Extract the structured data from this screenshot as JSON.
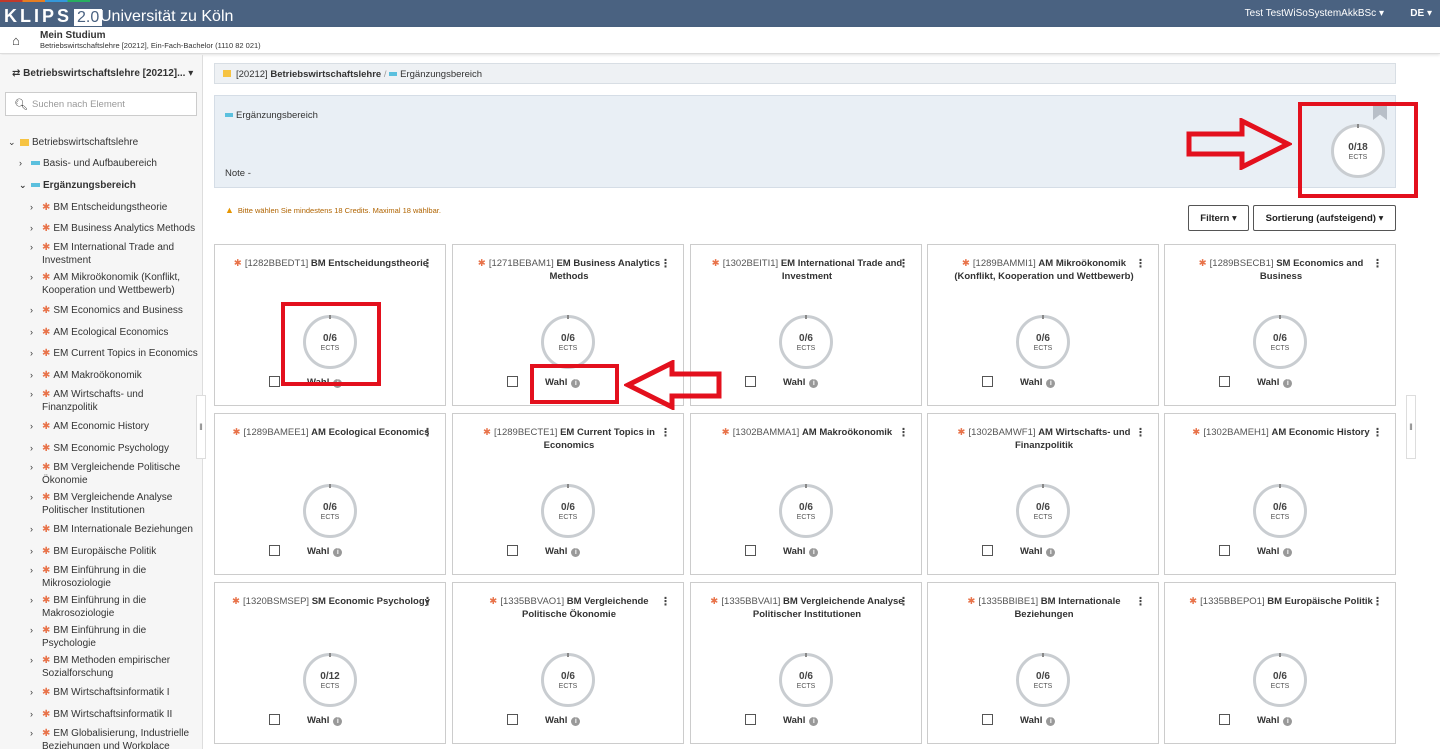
{
  "topbar": {
    "brand": "KLIPS",
    "version": "2.0",
    "university": "Universität zu Köln",
    "user": "Test TestWiSoSystemAkkBSc",
    "language": "DE"
  },
  "subheader": {
    "title": "Mein Studium",
    "subtitle": "Betriebswirtschaftslehre [20212], Ein-Fach-Bachelor (1110 82 021)"
  },
  "sidebar": {
    "program_selector": "Betriebswirtschaftslehre [20212]...",
    "search_placeholder": "Suchen nach Element",
    "tree": {
      "root": "Betriebswirtschaftslehre",
      "basis": "Basis- und Aufbaubereich",
      "erg": "Ergänzungsbereich",
      "items": [
        "BM Entscheidungstheorie",
        "EM Business Analytics Methods",
        "EM International Trade and Investment",
        "AM Mikroökonomik (Konflikt, Kooperation und Wettbewerb)",
        "SM Economics and Business",
        "AM Ecological Economics",
        "EM Current Topics in Economics",
        "AM Makroökonomik",
        "AM Wirtschafts- und Finanzpolitik",
        "AM Economic History",
        "SM Economic Psychology",
        "BM Vergleichende Politische Ökonomie",
        "BM Vergleichende Analyse Politischer Institutionen",
        "BM Internationale Beziehungen",
        "BM Europäische Politik",
        "BM Einführung in die Mikrosoziologie",
        "BM Einführung in die Makrosoziologie",
        "BM Einführung in die Psychologie",
        "BM Methoden empirischer Sozialforschung",
        "BM Wirtschaftsinformatik I",
        "BM Wirtschaftsinformatik II",
        "EM Globalisierung, Industrielle Beziehungen und Workplace"
      ]
    }
  },
  "breadcrumb": {
    "code": "[20212]",
    "program": "Betriebswirtschaftslehre",
    "separator": "/",
    "current": "Ergänzungsbereich"
  },
  "panel": {
    "title": "Ergänzungsbereich",
    "note_label": "Note",
    "note_value": "-",
    "ects_value": "0/18",
    "ects_unit": "ECTS"
  },
  "warning": "Bitte wählen Sie mindestens 18 Credits. Maximal 18 wählbar.",
  "toolbar": {
    "filter": "Filtern ▾",
    "sort": "Sortierung (aufsteigend) ▾"
  },
  "card_labels": {
    "wahl": "Wahl",
    "ects": "ECTS"
  },
  "cards": [
    {
      "code": "[1282BBEDT1]",
      "name": "BM Entscheidungstheorie",
      "ects": "0/6"
    },
    {
      "code": "[1271BEBAM1]",
      "name": "EM Business Analytics Methods",
      "ects": "0/6"
    },
    {
      "code": "[1302BEITI1]",
      "name": "EM International Trade and Investment",
      "ects": "0/6"
    },
    {
      "code": "[1289BAMMI1]",
      "name": "AM Mikroökonomik (Konflikt, Kooperation und Wettbewerb)",
      "ects": "0/6"
    },
    {
      "code": "[1289BSECB1]",
      "name": "SM Economics and Business",
      "ects": "0/6"
    },
    {
      "code": "[1289BAMEE1]",
      "name": "AM Ecological Economics",
      "ects": "0/6"
    },
    {
      "code": "[1289BECTE1]",
      "name": "EM Current Topics in Economics",
      "ects": "0/6"
    },
    {
      "code": "[1302BAMMA1]",
      "name": "AM Makroökonomik",
      "ects": "0/6"
    },
    {
      "code": "[1302BAMWF1]",
      "name": "AM Wirtschafts- und Finanzpolitik",
      "ects": "0/6"
    },
    {
      "code": "[1302BAMEH1]",
      "name": "AM Economic History",
      "ects": "0/6"
    },
    {
      "code": "[1320BSMSEP]",
      "name": "SM Economic Psychology",
      "ects": "0/12"
    },
    {
      "code": "[1335BBVAO1]",
      "name": "BM Vergleichende Politische Ökonomie",
      "ects": "0/6"
    },
    {
      "code": "[1335BBVAI1]",
      "name": "BM Vergleichende Analyse Politischer Institutionen",
      "ects": "0/6"
    },
    {
      "code": "[1335BBIBE1]",
      "name": "BM Internationale Beziehungen",
      "ects": "0/6"
    },
    {
      "code": "[1335BBEPO1]",
      "name": "BM Europäische Politik",
      "ects": "0/6"
    }
  ],
  "colors": {
    "topbar": "#4a6281",
    "accent_orange": "#e8734a",
    "annotation_red": "#e3101d"
  }
}
